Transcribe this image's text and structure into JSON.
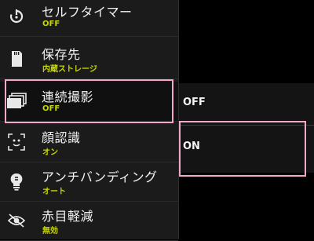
{
  "menu": {
    "items": [
      {
        "label": "セルフタイマー",
        "value": "OFF",
        "icon": "self-timer-icon"
      },
      {
        "label": "保存先",
        "value": "内蔵ストレージ",
        "icon": "sd-card-icon"
      },
      {
        "label": "連続撮影",
        "value": "OFF",
        "icon": "continuous-shooting-icon"
      },
      {
        "label": "顔認識",
        "value": "オン",
        "icon": "face-detection-icon"
      },
      {
        "label": "アンチバンディング",
        "value": "オート",
        "icon": "anti-banding-icon"
      },
      {
        "label": "赤目軽減",
        "value": "無効",
        "icon": "red-eye-icon"
      }
    ]
  },
  "submenu": {
    "options": [
      {
        "label": "OFF"
      },
      {
        "label": "ON"
      }
    ]
  },
  "colors": {
    "value_text": "#c6d600",
    "highlight_border": "#f0a7c8",
    "menu_background": "#1b1b1b"
  }
}
